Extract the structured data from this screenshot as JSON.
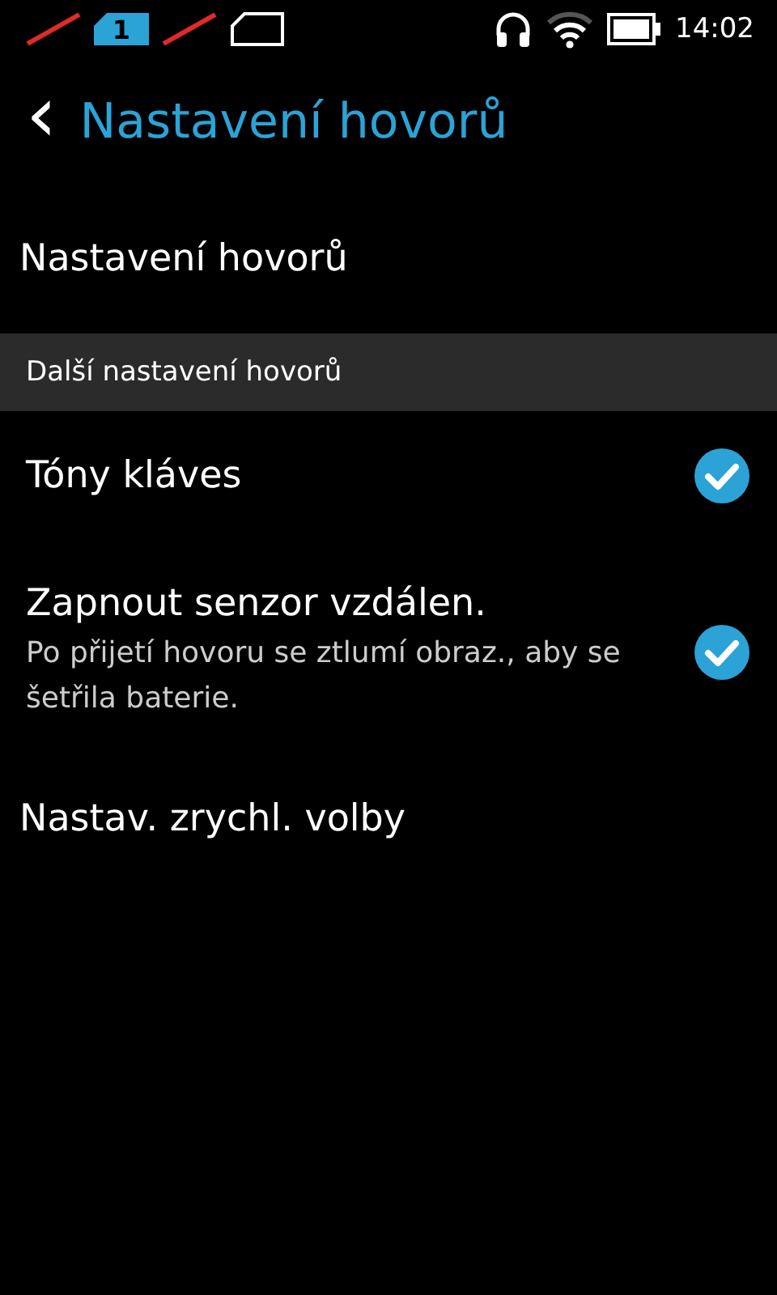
{
  "status_bar": {
    "sim_badge": "1",
    "time": "14:02"
  },
  "header": {
    "back_icon": "‹",
    "title": "Nastavení hovorů"
  },
  "items": [
    {
      "kind": "plain",
      "label": "Nastavení hovorů"
    },
    {
      "kind": "section",
      "label": "Další nastavení hovorů"
    },
    {
      "kind": "check",
      "label": "Tóny kláves",
      "checked": true
    },
    {
      "kind": "check",
      "label": "Zapnout senzor vzdálen.",
      "description": "Po přijetí hovoru se ztlumí obraz., aby se šetřila baterie.",
      "checked": true
    },
    {
      "kind": "plain",
      "label": "Nastav. zrychl. volby"
    }
  ]
}
